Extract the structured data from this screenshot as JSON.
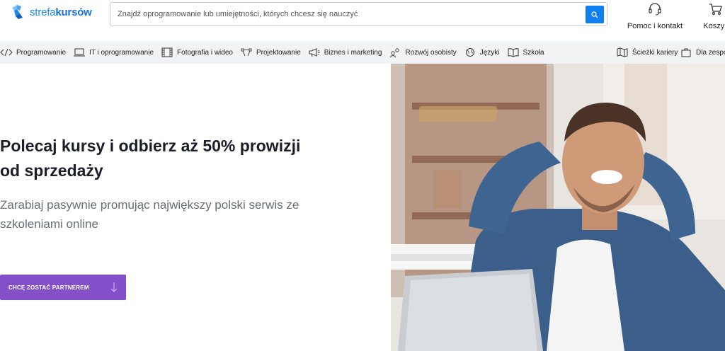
{
  "header": {
    "logo": {
      "prefix": "strefa",
      "bold": "kursów"
    },
    "search": {
      "placeholder": "Znajdź oprogramowanie lub umiejętności, których chcesz się nauczyć",
      "value": ""
    },
    "help_label": "Pomoc i kontakt",
    "cart_label": "Koszyk",
    "accent": "#0f7ef0"
  },
  "categories": [
    {
      "label": "Programowanie",
      "icon": "code-icon"
    },
    {
      "label": "IT i oprogramowanie",
      "icon": "laptop-icon"
    },
    {
      "label": "Fotografia i wideo",
      "icon": "film-icon"
    },
    {
      "label": "Projektowanie",
      "icon": "design-icon"
    },
    {
      "label": "Biznes i marketing",
      "icon": "megaphone-icon"
    },
    {
      "label": "Rozwój osobisty",
      "icon": "people-icon"
    },
    {
      "label": "Języki",
      "icon": "globe-icon"
    },
    {
      "label": "Szkoła",
      "icon": "book-icon"
    }
  ],
  "nav_right": [
    {
      "label": "Ścieżki kariery",
      "icon": "map-icon"
    },
    {
      "label": "Dla zespo",
      "icon": "briefcase-icon"
    }
  ],
  "hero": {
    "headline_line1": "Polecaj kursy i odbierz aż 50% prowizji",
    "headline_line2": "od sprzedaży",
    "subtitle_line1": "Zarabiaj pasywnie promując największy polski serwis ze",
    "subtitle_line2": "szkoleniami online",
    "cta_label": "CHCĘ ZOSTAĆ PARTNEREM",
    "cta_color": "#8450c8"
  }
}
